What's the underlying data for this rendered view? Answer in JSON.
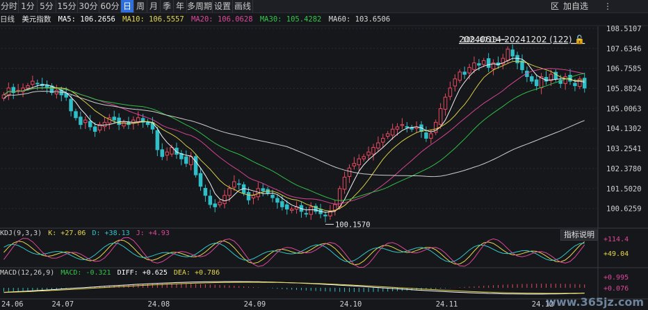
{
  "toolbar": {
    "tabs": [
      "分时",
      "1分",
      "5分",
      "15分",
      "30分",
      "60分",
      "日",
      "周",
      "月",
      "季",
      "年",
      "多周期",
      "设置",
      "画线"
    ],
    "active_index": 6,
    "right_buttons": [
      "区",
      "加自选",
      "⋮"
    ]
  },
  "legend": {
    "period": "日线",
    "symbol": "美元指数",
    "items": [
      {
        "label": "MA5: 106.2656",
        "color": "#ffffff"
      },
      {
        "label": "MA10: 106.5557",
        "color": "#e6d84a"
      },
      {
        "label": "MA20: 106.0628",
        "color": "#e0479a"
      },
      {
        "label": "MA30: 105.4282",
        "color": "#31c74a"
      },
      {
        "label": "MA60: 103.6506",
        "color": "#d8d8d8"
      }
    ]
  },
  "kdj": {
    "label": "KDJ(9,3,3)",
    "k": "K: +27.06",
    "d": "D: +38.13",
    "j": "J: +4.93",
    "axis": [
      "+114.4",
      "+49.04"
    ],
    "button": "指标说明"
  },
  "macd": {
    "label": "MACD(12,26,9)",
    "macd": "MACD: -0.321",
    "diff": "DIFF: +0.625",
    "dea": "DEA: +0.786",
    "axis": [
      "+0.995",
      "+0.076"
    ]
  },
  "watermark": "www.365jz.com",
  "chart_data": {
    "type": "candlestick",
    "range_label": "20240614-20241202 (122)",
    "high_label": "108.0710",
    "low_label": "100.1570",
    "y_ticks": [
      "108.5107",
      "107.6346",
      "106.7585",
      "105.8824",
      "105.0063",
      "104.1302",
      "103.2541",
      "102.3780",
      "101.5020",
      "100.6259"
    ],
    "y_tick_values": [
      108.5107,
      107.6346,
      106.7585,
      105.8824,
      105.0063,
      104.1302,
      103.2541,
      102.378,
      101.502,
      100.6259
    ],
    "x_labels": [
      "24.06",
      "24.07",
      "24.08",
      "24.09",
      "24.10",
      "24.11",
      "24.12"
    ],
    "x_label_index": [
      0,
      10,
      30,
      50,
      70,
      90,
      110
    ],
    "closes": [
      105.6,
      105.9,
      105.7,
      105.8,
      105.9,
      106.0,
      106.2,
      106.1,
      106.0,
      105.9,
      105.7,
      105.8,
      105.6,
      105.5,
      104.9,
      104.6,
      104.3,
      104.5,
      104.2,
      104.0,
      104.3,
      104.4,
      104.6,
      104.5,
      104.3,
      104.4,
      104.3,
      104.5,
      104.6,
      104.4,
      104.3,
      104.1,
      103.2,
      102.9,
      103.1,
      103.3,
      103.0,
      102.8,
      102.6,
      102.9,
      102.1,
      101.6,
      101.2,
      100.8,
      100.7,
      100.9,
      101.2,
      101.5,
      101.8,
      101.7,
      101.3,
      101.0,
      101.2,
      101.5,
      101.4,
      101.3,
      101.1,
      100.9,
      100.7,
      100.6,
      100.6,
      100.7,
      100.5,
      100.4,
      100.7,
      100.5,
      100.4,
      100.3,
      100.5,
      100.8,
      101.5,
      102.0,
      102.4,
      102.6,
      102.8,
      102.9,
      103.1,
      103.3,
      103.5,
      103.7,
      103.9,
      104.1,
      104.2,
      104.3,
      104.2,
      104.1,
      104.2,
      104.0,
      103.7,
      103.9,
      104.4,
      105.0,
      105.5,
      105.9,
      106.3,
      106.6,
      106.5,
      106.8,
      107.0,
      106.9,
      107.1,
      106.8,
      107.0,
      106.9,
      107.2,
      107.6,
      107.3,
      107.0,
      106.7,
      106.4,
      106.2,
      106.0,
      106.4,
      106.2,
      106.5,
      106.3,
      106.1,
      106.4,
      106.2,
      106.0,
      106.3,
      105.9
    ],
    "ma_series": [
      {
        "name": "MA5",
        "color": "#ffffff"
      },
      {
        "name": "MA10",
        "color": "#e6d84a"
      },
      {
        "name": "MA20",
        "color": "#e0479a"
      },
      {
        "name": "MA30",
        "color": "#31c74a"
      },
      {
        "name": "MA60",
        "color": "#d8d8d8"
      }
    ],
    "up_color": "#e84a5f",
    "down_color": "#2fbfc9"
  }
}
